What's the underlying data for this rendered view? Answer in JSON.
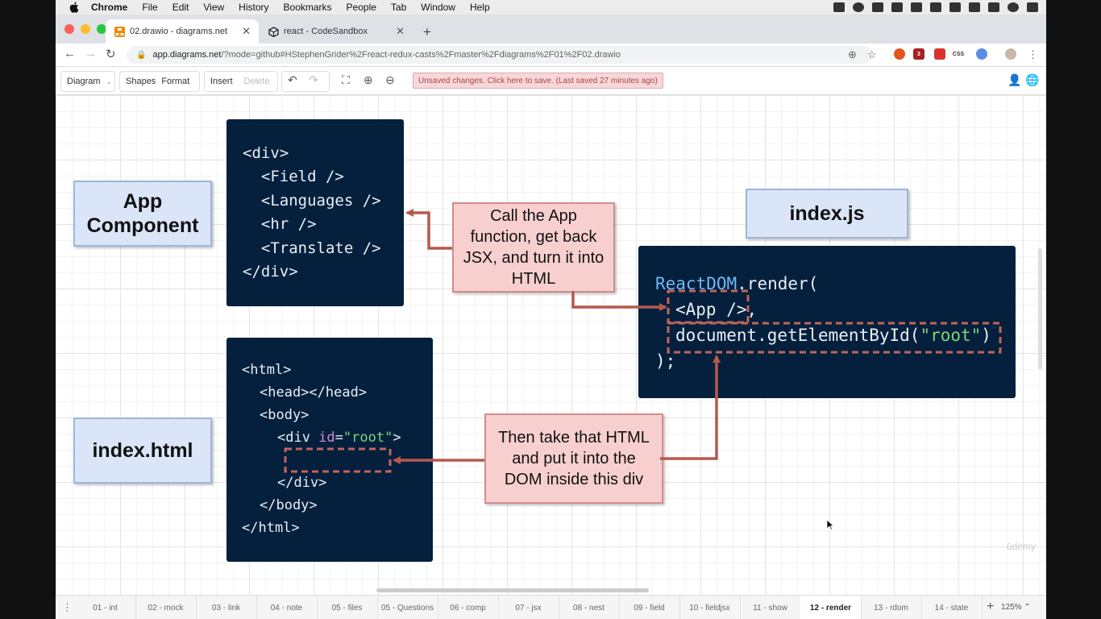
{
  "menubar": {
    "app": "Chrome",
    "items": [
      "File",
      "Edit",
      "View",
      "History",
      "Bookmarks",
      "People",
      "Tab",
      "Window",
      "Help"
    ]
  },
  "tabs": [
    {
      "title": "02.drawio - diagrams.net",
      "icon": "drawio-icon",
      "active": true
    },
    {
      "title": "react - CodeSandbox",
      "icon": "codesandbox-icon",
      "active": false
    }
  ],
  "address": {
    "host": "app.diagrams.net",
    "path": "/?mode=github#HStephenGrider%2Freact-redux-casts%2Fmaster%2Fdiagrams%2F01%2F02.drawio"
  },
  "extensions": {
    "css_label": "CSS",
    "badge": "3"
  },
  "toolbar": {
    "diagram": "Diagram",
    "shapes": "Shapes",
    "format": "Format",
    "insert": "Insert",
    "delete": "Delete",
    "unsaved": "Unsaved changes. Click here to save. (Last saved 27 minutes ago)"
  },
  "diagram": {
    "app_component_line1": "App",
    "app_component_line2": "Component",
    "index_js": "index.js",
    "index_html": "index.html",
    "jsx_code": [
      "<div>",
      "  <Field />",
      "  <Languages />",
      "  <hr />",
      "  <Translate />",
      "</div>"
    ],
    "note1": [
      "Call the App",
      "function, get back",
      "JSX, and turn it into",
      "HTML"
    ],
    "note2": [
      "Then take that HTML",
      "and put it into the",
      "DOM inside this div"
    ],
    "render_code": {
      "line1_obj": "ReactDOM",
      "line1_rest": ".render(",
      "line2": "<App />",
      "line2_comma": ",",
      "line3_a": "document.getElementById(",
      "line3_str": "\"root\"",
      "line3_b": ")",
      "line4": ");"
    },
    "html_code": {
      "l1": "<html>",
      "l2": "<head></head>",
      "l3": "<body>",
      "l4_a": "<div ",
      "l4_attr": "id",
      "l4_eq": "=",
      "l4_str": "\"root\"",
      "l4_b": ">",
      "l5": "</div>",
      "l6": "</body>",
      "l7": "</html>"
    },
    "watermark": "ūdemy"
  },
  "pages": [
    {
      "label": "01 - int",
      "active": false
    },
    {
      "label": "02 - mock",
      "active": false
    },
    {
      "label": "03 - link",
      "active": false
    },
    {
      "label": "04 - note",
      "active": false
    },
    {
      "label": "05 - files",
      "active": false
    },
    {
      "label": "05 - Questions",
      "active": false
    },
    {
      "label": "06 - comp",
      "active": false
    },
    {
      "label": "07 - jsx",
      "active": false
    },
    {
      "label": "08 - nest",
      "active": false
    },
    {
      "label": "09 - field",
      "active": false
    },
    {
      "label": "10 - fieldjsx",
      "active": false
    },
    {
      "label": "11 - show",
      "active": false
    },
    {
      "label": "12 - render",
      "active": true
    },
    {
      "label": "13 - rdom",
      "active": false
    },
    {
      "label": "14 - state",
      "active": false
    }
  ],
  "zoom": "125%",
  "colors": {
    "code_bg": "#05203c",
    "note_bg": "#f8cfcf",
    "label_bg": "#dae6f8",
    "arrow": "#b5594f"
  }
}
